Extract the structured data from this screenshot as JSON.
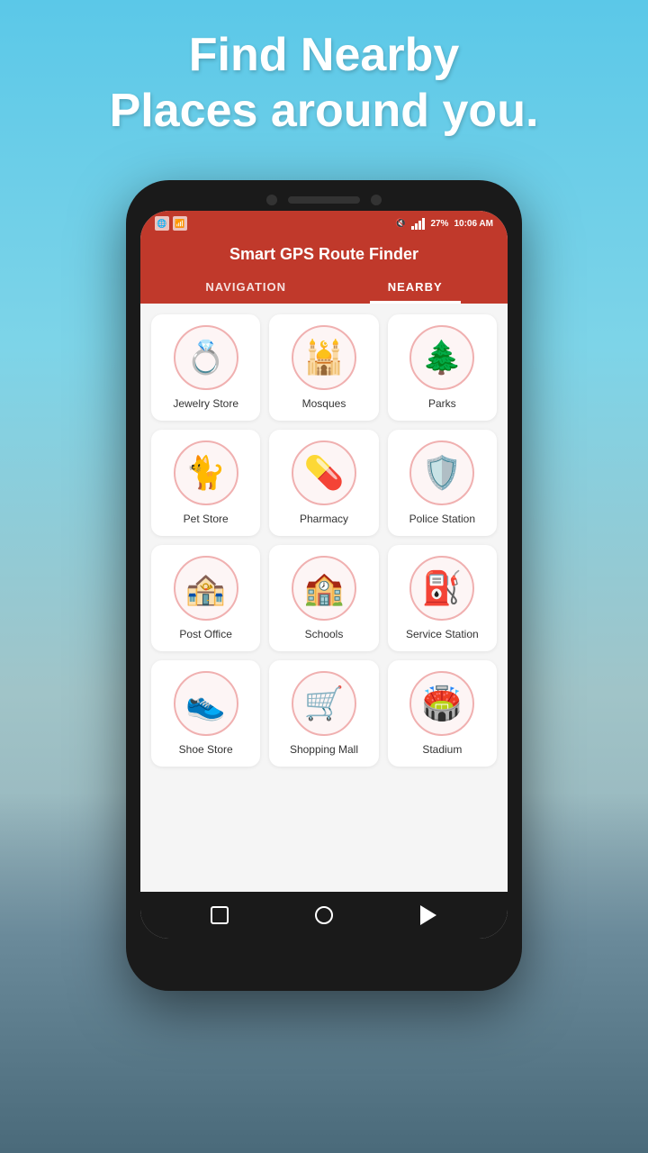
{
  "header": {
    "line1": "Find Nearby",
    "line2": "Places around you."
  },
  "statusBar": {
    "time": "10:06 AM",
    "battery": "27%",
    "signal": "signal"
  },
  "appTitle": "Smart GPS Route Finder",
  "tabs": [
    {
      "label": "NAVIGATION",
      "active": false
    },
    {
      "label": "NEARBY",
      "active": true
    }
  ],
  "gridItems": [
    {
      "label": "Jewelry Store",
      "icon": "💍"
    },
    {
      "label": "Mosques",
      "icon": "🕌"
    },
    {
      "label": "Parks",
      "icon": "🌲"
    },
    {
      "label": "Pet Store",
      "icon": "🐈"
    },
    {
      "label": "Pharmacy",
      "icon": "💊"
    },
    {
      "label": "Police Station",
      "icon": "🛡️"
    },
    {
      "label": "Post Office",
      "icon": "🏤"
    },
    {
      "label": "Schools",
      "icon": "🏫"
    },
    {
      "label": "Service Station",
      "icon": "⛽"
    },
    {
      "label": "Shoe Store",
      "icon": "👟"
    },
    {
      "label": "Shopping Mall",
      "icon": "🛒"
    },
    {
      "label": "Stadium",
      "icon": "🏟️"
    }
  ],
  "bottomNav": {
    "back": "square",
    "home": "circle",
    "recent": "triangle"
  }
}
